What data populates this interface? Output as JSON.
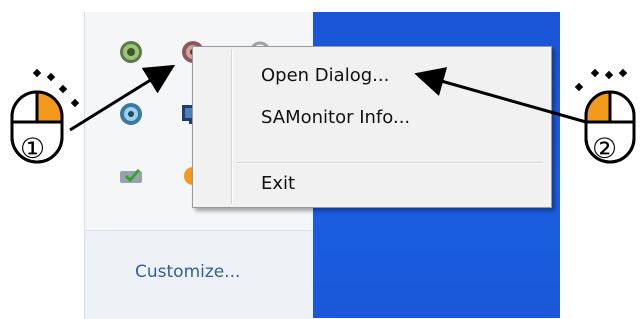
{
  "context_menu": {
    "items": [
      {
        "label": "Open Dialog..."
      },
      {
        "label": "SAMonitor Info..."
      },
      {
        "label": "Exit"
      }
    ]
  },
  "tray": {
    "customize_label": "Customize..."
  },
  "callouts": {
    "step1": "①",
    "step2": "②"
  },
  "colors": {
    "desktop": "#1b5fe3",
    "mouse_highlight": "#f39a1c",
    "menu_bg": "#f1f1f1",
    "link": "#2f5f9f"
  },
  "icons": [
    "gear-icon",
    "network-icon",
    "monitor-icon",
    "checkmark-icon",
    "orange-status-icon",
    "mouse-left-click-icon",
    "mouse-right-click-icon"
  ]
}
